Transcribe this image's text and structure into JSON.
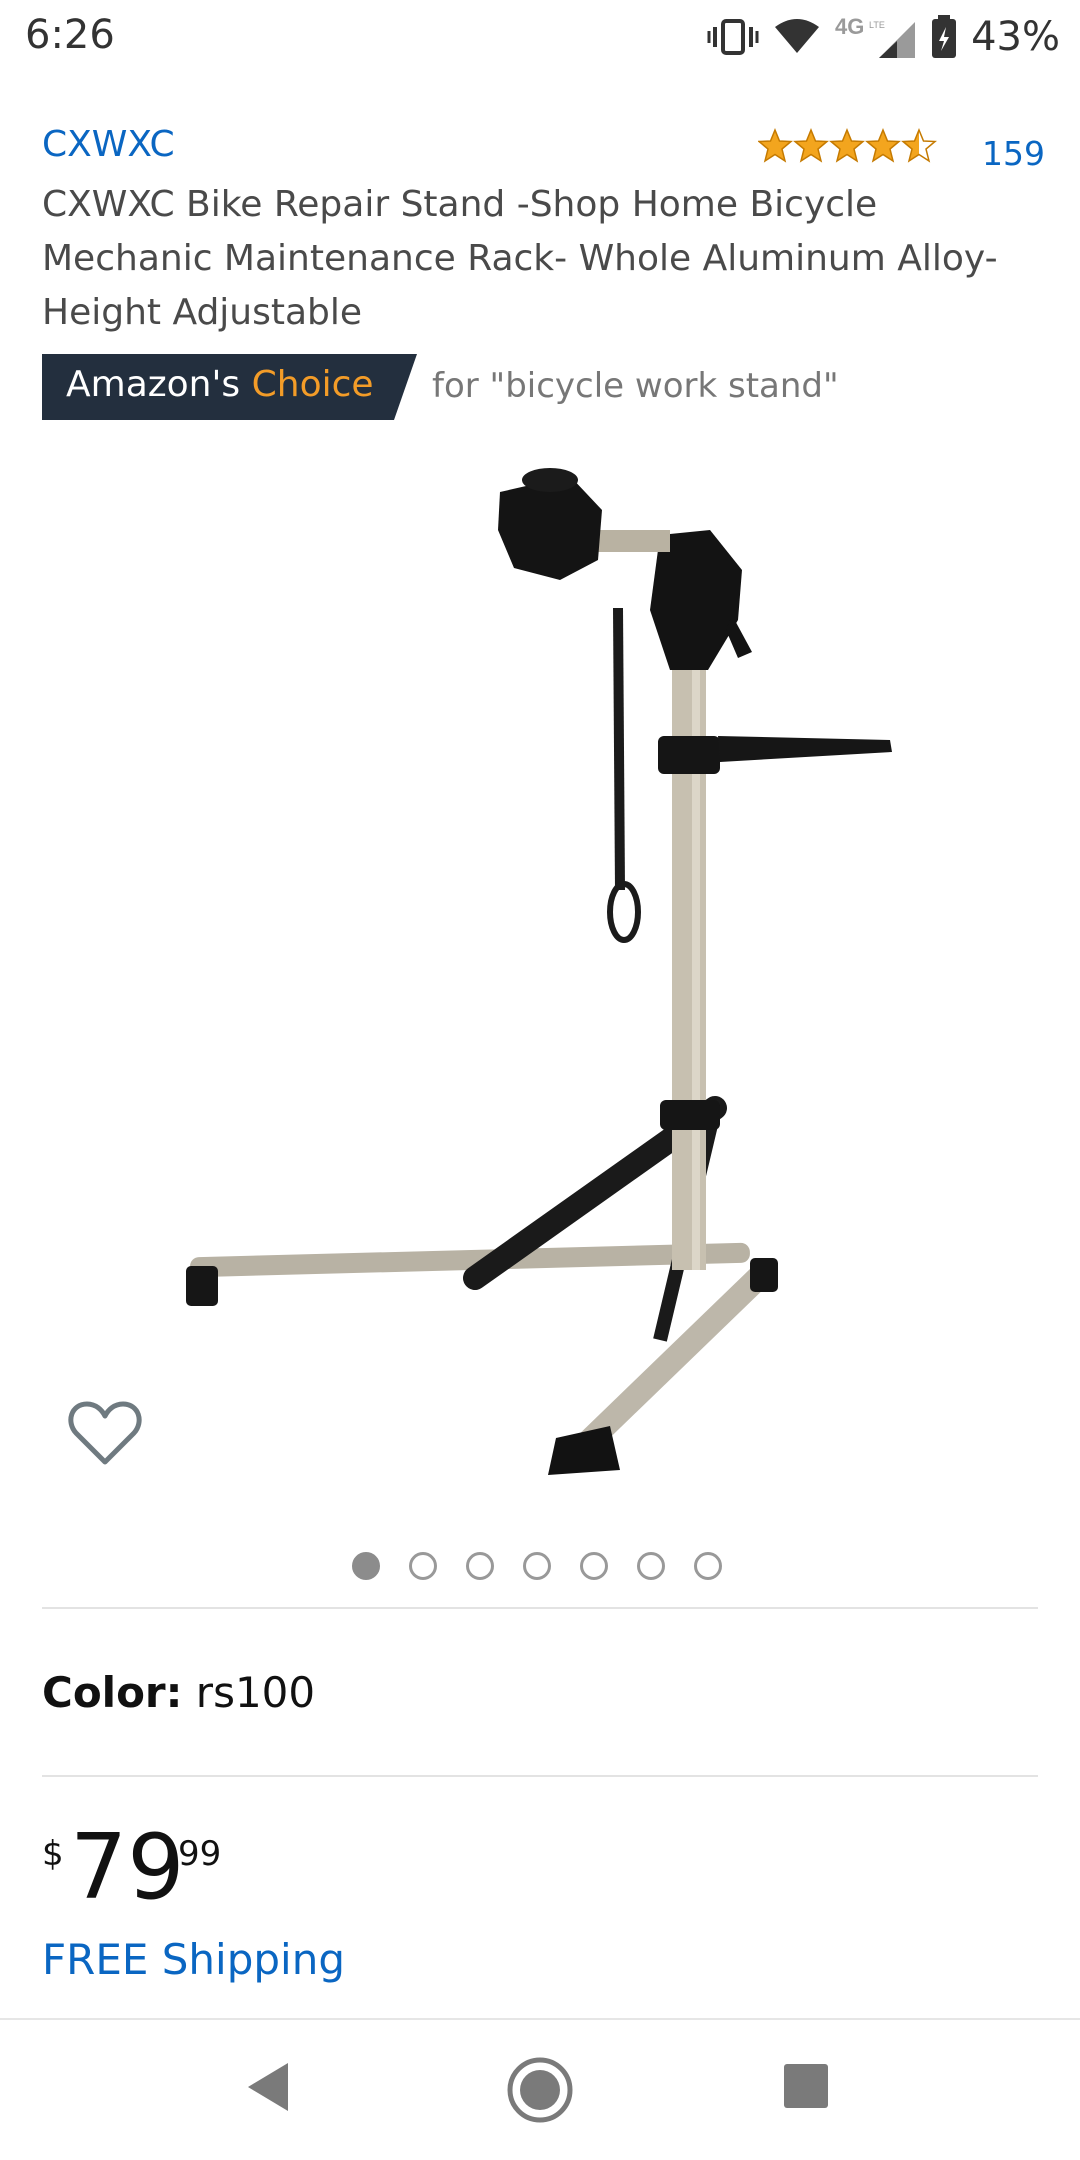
{
  "status_bar": {
    "time": "6:26",
    "network": "4G LTE",
    "battery": "43%"
  },
  "product": {
    "brand": "CXWXC",
    "rating_stars": 4.5,
    "rating_count": "159",
    "title": "CXWXC Bike Repair Stand -Shop Home Bicycle Mechanic Maintenance Rack- Whole Aluminum Alloy-Height Adjustable",
    "badge": {
      "prefix": "Amazon's",
      "highlight": "Choice",
      "for_text": "for \"bicycle work stand\""
    },
    "image_count": 7,
    "active_image": 1,
    "color_label": "Color:",
    "color_value": "rs100",
    "price": {
      "symbol": "$",
      "whole": "79",
      "fraction": "99"
    },
    "shipping": "FREE Shipping"
  },
  "icons": {
    "wishlist": "heart-outline-icon",
    "back": "back-triangle-icon",
    "home": "home-circle-icon",
    "recents": "recents-square-icon"
  },
  "colors": {
    "link": "#0a66c2",
    "badge_bg": "#232f3e",
    "badge_accent": "#f39c28",
    "star": "#f3a51e"
  }
}
